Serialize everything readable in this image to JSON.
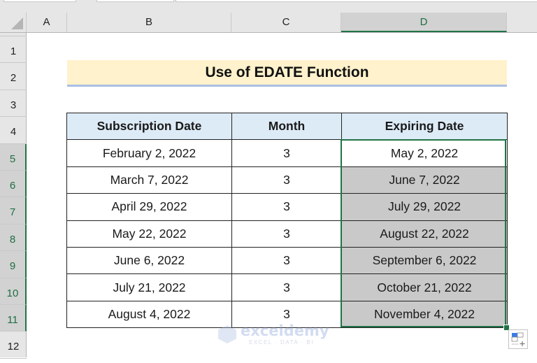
{
  "app": "Microsoft Excel",
  "columns": [
    {
      "label": "A",
      "selected": false
    },
    {
      "label": "B",
      "selected": false
    },
    {
      "label": "C",
      "selected": false
    },
    {
      "label": "D",
      "selected": true
    }
  ],
  "rows": [
    {
      "label": "1",
      "selected": false
    },
    {
      "label": "2",
      "selected": false
    },
    {
      "label": "3",
      "selected": false
    },
    {
      "label": "4",
      "selected": false
    },
    {
      "label": "5",
      "selected": true
    },
    {
      "label": "6",
      "selected": true
    },
    {
      "label": "7",
      "selected": true
    },
    {
      "label": "8",
      "selected": true
    },
    {
      "label": "9",
      "selected": true
    },
    {
      "label": "10",
      "selected": true
    },
    {
      "label": "11",
      "selected": true
    },
    {
      "label": "12",
      "selected": false
    }
  ],
  "sheet": {
    "title": "Use of EDATE Function",
    "headers": [
      "Subscription Date",
      "Month",
      "Expiring Date"
    ],
    "table": [
      [
        "February 2, 2022",
        "3",
        "May 2, 2022"
      ],
      [
        "March 7, 2022",
        "3",
        "June 7, 2022"
      ],
      [
        "April 29, 2022",
        "3",
        "July 29, 2022"
      ],
      [
        "May 22, 2022",
        "3",
        "August 22, 2022"
      ],
      [
        "June 6, 2022",
        "3",
        "September 6, 2022"
      ],
      [
        "July 21, 2022",
        "3",
        "October 21, 2022"
      ],
      [
        "August 4, 2022",
        "3",
        "November 4, 2022"
      ]
    ],
    "selected_range": "D5:D11"
  },
  "colors": {
    "selection": "#217346",
    "title_fill": "#fff2cc",
    "header_fill": "#ddebf7",
    "expiring_fill": "#c9c9c9"
  },
  "watermark": {
    "name": "exceldemy",
    "tagline": "EXCEL · DATA · BI"
  },
  "icons": {
    "quick_analysis": "quick-analysis-icon",
    "select_all": "select-all-triangle-icon"
  }
}
